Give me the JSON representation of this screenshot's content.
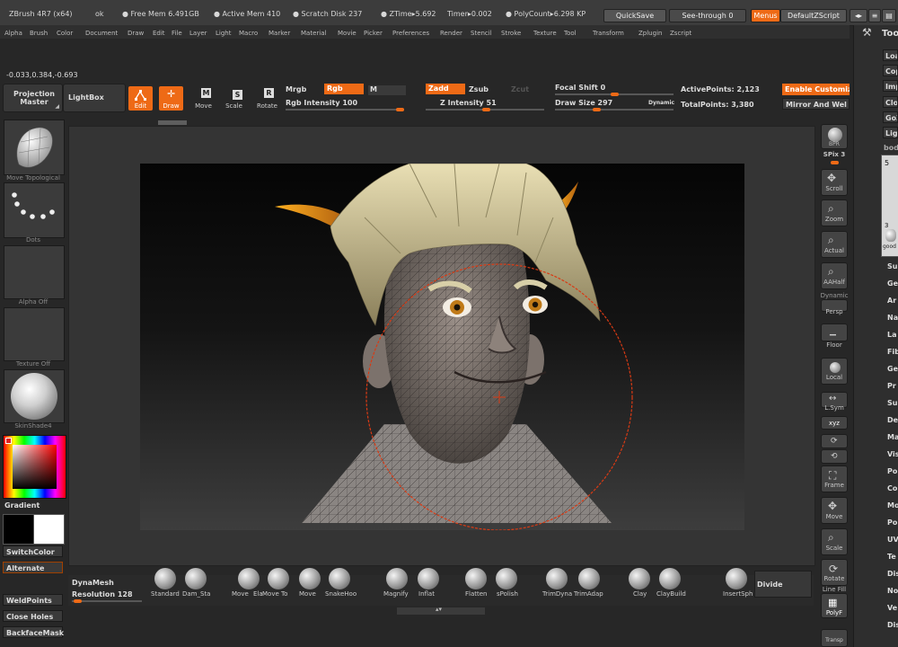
{
  "titlebar": {
    "app": "ZBrush 4R7 (x64)",
    "ok": "ok",
    "free_mem": "Free Mem 6.491GB",
    "active_mem": "Active Mem 410",
    "scratch_disk": "Scratch Disk 237",
    "ztime": "ZTime▸5.692",
    "timer": "Timer▸0.002",
    "polycount": "PolyCount▸6.298 KP",
    "quicksave": "QuickSave",
    "see_through": "See-through",
    "see_through_value": "0",
    "menus": "Menus",
    "default_zscript": "DefaultZScript"
  },
  "menubar": [
    "Alpha",
    "Brush",
    "Color",
    "Document",
    "Draw",
    "Edit",
    "File",
    "Layer",
    "Light",
    "Macro",
    "Marker",
    "Material",
    "Movie",
    "Picker",
    "Preferences",
    "Render",
    "Stencil",
    "Stroke",
    "Texture",
    "Tool",
    "Transform",
    "Zplugin",
    "Zscript"
  ],
  "coordinates": "-0.033,0.384,-0.693",
  "top_shelf": {
    "projection_master": "Projection Master",
    "lightbox": "LightBox",
    "edit": "Edit",
    "draw": "Draw",
    "move": "Move",
    "scale": "Scale",
    "rotate": "Rotate",
    "mrgb": "Mrgb",
    "rgb": "Rgb",
    "m": "M",
    "rgb_intensity": "Rgb Intensity 100",
    "rgb_intensity_value": 100,
    "zadd": "Zadd",
    "zsub": "Zsub",
    "zcut": "Zcut",
    "z_intensity": "Z Intensity 51",
    "z_intensity_value": 51,
    "focal_shift": "Focal Shift 0",
    "draw_size": "Draw Size 297",
    "dynamic": "Dynamic",
    "active_points": "ActivePoints: 2,123",
    "total_points": "TotalPoints: 3,380",
    "enable_customize": "Enable Customiz",
    "mirror_and_weld": "Mirror And Wel"
  },
  "left_shelf": {
    "brush_label": "Move Topological",
    "stroke_label": "Dots",
    "alpha_label": "Alpha Off",
    "texture_label": "Texture Off",
    "material_label": "SkinShade4",
    "gradient": "Gradient",
    "switch_color": "SwitchColor",
    "alternate": "Alternate",
    "weld_points": "WeldPoints",
    "close_holes": "Close Holes",
    "backface_mask": "BackfaceMask"
  },
  "right_shelf": {
    "bpr": "BPR",
    "spix": "SPix 3",
    "scroll": "Scroll",
    "zoom": "Zoom",
    "actual": "Actual",
    "aahalf": "AAHalf",
    "dynamic": "Dynamic",
    "persp": "Persp",
    "floor": "Floor",
    "local": "Local",
    "lsym": "L.Sym",
    "xyz": "xyz",
    "frame": "Frame",
    "move": "Move",
    "scale": "Scale",
    "rotate": "Rotate",
    "line_fill": "Line Fill",
    "polyf": "PolyF",
    "transp": "Transp"
  },
  "tool_palette": {
    "title": "Too",
    "buttons": [
      "Loa",
      "Cop",
      "Imp",
      "Clo",
      "GoZ",
      "Ligh"
    ],
    "subtool_name": "body",
    "thumb_num": "5",
    "thumb_small": "3",
    "thumb_caption": "good",
    "items": [
      "Su",
      "Ge",
      "Ar",
      "Na",
      "La",
      "Fib",
      "Ge",
      "Pr",
      "Su",
      "De",
      "Ma",
      "Vis",
      "Po",
      "Co",
      "Mo",
      "Po",
      "UV",
      "Te",
      "Dis",
      "No",
      "Ve",
      "Dis"
    ]
  },
  "bottom_shelf": {
    "dynamesh": "DynaMesh",
    "resolution": "Resolution 128",
    "divide": "Divide",
    "brushes": [
      "Standard",
      "Dam_Sta",
      "Move",
      "Ela",
      "Move To",
      "Move",
      "SnakeHoo",
      "Magnify",
      "Inflat",
      "Flatten",
      "sPolish",
      "TrimDyna",
      "TrimAdap",
      "Clay",
      "ClayBuild",
      "InsertSph"
    ]
  }
}
